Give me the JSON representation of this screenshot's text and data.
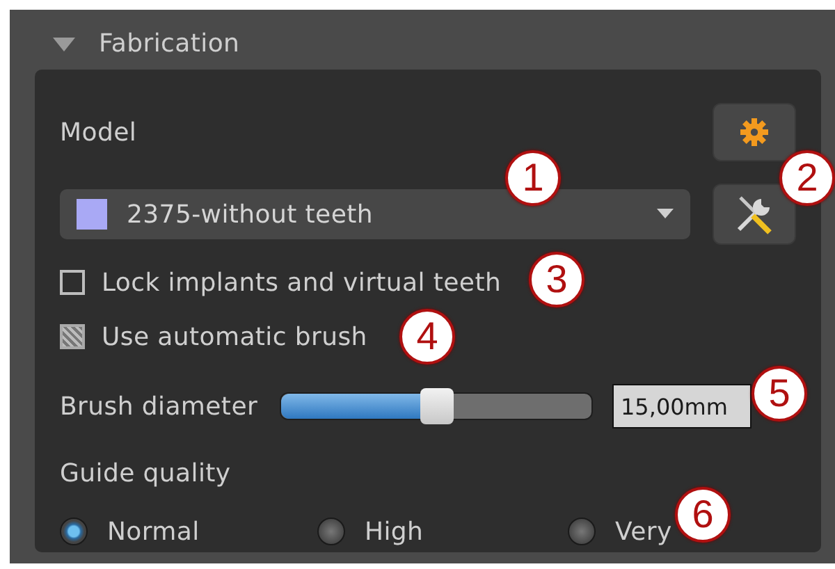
{
  "section": {
    "title": "Fabrication",
    "expanded": true
  },
  "model": {
    "label": "Model",
    "value": "2375-without teeth",
    "color": "#a9a9f5"
  },
  "checkboxes": [
    {
      "label": "Lock implants and virtual teeth",
      "checked": false
    },
    {
      "label": "Use automatic brush",
      "checked": true
    }
  ],
  "brush": {
    "label": "Brush diameter",
    "level": 0.5,
    "value": "15,00mm"
  },
  "guide_quality": {
    "label": "Guide quality",
    "options": [
      {
        "label": "Normal",
        "selected": true
      },
      {
        "label": "High",
        "selected": false
      },
      {
        "label": "Very",
        "selected": false
      }
    ]
  },
  "callouts": [
    {
      "label": "1"
    },
    {
      "label": "2"
    },
    {
      "label": "3"
    },
    {
      "label": "4"
    },
    {
      "label": "5"
    },
    {
      "label": "6"
    }
  ]
}
